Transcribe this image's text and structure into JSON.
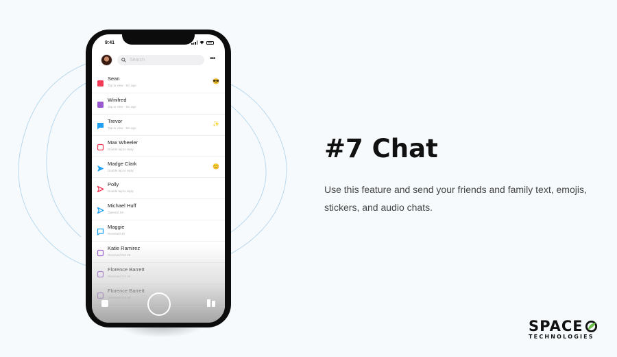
{
  "phone": {
    "status_time": "9:41",
    "search_placeholder": "Search",
    "more_label": "•••",
    "chats": [
      {
        "name": "Sean",
        "sub": "Tap to view · 5m ago",
        "icon": "filled-square",
        "color": "#f23c57",
        "emoji": "😎"
      },
      {
        "name": "Winifred",
        "sub": "Tap to view · 5m ago",
        "icon": "filled-square",
        "color": "#9b59d0",
        "emoji": ""
      },
      {
        "name": "Trevor",
        "sub": "Tap to view · 6m ago",
        "icon": "filled-chat",
        "color": "#1ea0f0",
        "emoji": "✨"
      },
      {
        "name": "Max Wheeler",
        "sub": "Double tap to reply",
        "icon": "outline-square",
        "color": "#f23c57",
        "emoji": ""
      },
      {
        "name": "Madge Clark",
        "sub": "Double tap to reply",
        "icon": "filled-arrow",
        "color": "#1ea0f0",
        "emoji": "😊"
      },
      {
        "name": "Polly",
        "sub": "Double tap to reply",
        "icon": "outline-arrow",
        "color": "#f23c57",
        "emoji": ""
      },
      {
        "name": "Michael Huff",
        "sub": "Opened 1m",
        "icon": "outline-arrow",
        "color": "#1ea0f0",
        "emoji": ""
      },
      {
        "name": "Maggie",
        "sub": "Received 4h",
        "icon": "outline-chat",
        "color": "#1ea0f0",
        "emoji": ""
      },
      {
        "name": "Katie Ramirez",
        "sub": "Received Oct 25",
        "icon": "outline-square",
        "color": "#9b59d0",
        "emoji": ""
      },
      {
        "name": "Florence Barrett",
        "sub": "Received Oct 25",
        "icon": "outline-square",
        "color": "#9b59d0",
        "emoji": ""
      },
      {
        "name": "Florence Barrett",
        "sub": "Received Oct 25",
        "icon": "outline-square",
        "color": "#9b59d0",
        "emoji": ""
      }
    ]
  },
  "headline": "#7 Chat",
  "description": "Use this feature and send your friends and family text, emojis, stickers, and audio chats.",
  "logo": {
    "top": "SPACE",
    "sub": "TECHNOLOGIES",
    "accent_color": "#6cc04a"
  }
}
